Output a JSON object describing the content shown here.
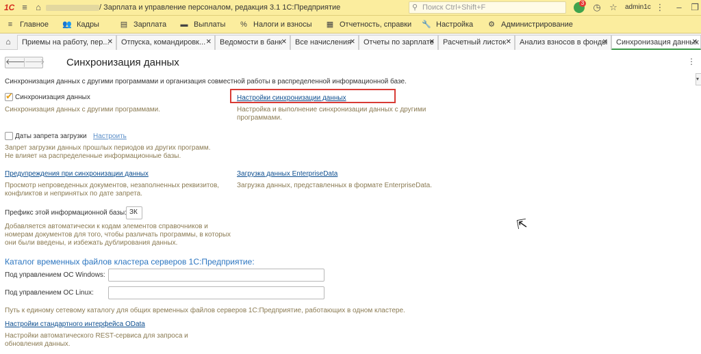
{
  "titlebar": {
    "logo": "1С",
    "app_title": "/ Зарплата и управление персоналом, редакция 3.1 1С:Предприятие",
    "search_placeholder": "Поиск Ctrl+Shift+F",
    "notification_count": "3",
    "user": "admin1c"
  },
  "menu": [
    {
      "label": "Главное",
      "icon": "menu-icon"
    },
    {
      "label": "Кадры",
      "icon": "people-icon"
    },
    {
      "label": "Зарплата",
      "icon": "wallet-icon"
    },
    {
      "label": "Выплаты",
      "icon": "payments-icon"
    },
    {
      "label": "Налоги и взносы",
      "icon": "percent-icon"
    },
    {
      "label": "Отчетность, справки",
      "icon": "reports-icon"
    },
    {
      "label": "Настройка",
      "icon": "wrench-icon"
    },
    {
      "label": "Администрирование",
      "icon": "gear-icon"
    }
  ],
  "tabs": [
    {
      "label": "Приемы на работу, пер..."
    },
    {
      "label": "Отпуска, командировк..."
    },
    {
      "label": "Ведомости в банк"
    },
    {
      "label": "Все начисления"
    },
    {
      "label": "Отчеты по зарплате"
    },
    {
      "label": "Расчетный листок"
    },
    {
      "label": "Анализ взносов в фонды"
    },
    {
      "label": "Синхронизация данных"
    }
  ],
  "page": {
    "title": "Синхронизация данных",
    "intro": "Синхронизация данных с другими программами и организация совместной работы в распределенной информационной базе."
  },
  "sync": {
    "checkbox_label": "Синхронизация данных",
    "checked": true,
    "desc": "Синхронизация данных с другими программами.",
    "settings_link": "Настройки синхронизации данных",
    "settings_desc_1": "Настройка и выполнение синхронизации данных с другими",
    "settings_desc_2": "программами."
  },
  "prohibit": {
    "checkbox_label": "Даты запрета загрузки",
    "checked": false,
    "configure_link": "Настроить",
    "desc_1": "Запрет загрузки данных прошлых периодов из других программ.",
    "desc_2": "Не влияет на распределенные информационные базы."
  },
  "warnings": {
    "link": "Предупреждения при синхронизации данных",
    "desc_1": "Просмотр непроведенных документов, незаполненных реквизитов,",
    "desc_2": "конфликтов и непринятых по дате запрета."
  },
  "enterprise_data": {
    "link": "Загрузка данных EnterpriseData",
    "desc": "Загрузка данных, представленных в формате EnterpriseData."
  },
  "prefix": {
    "label": "Префикс этой информационной базы:",
    "value": "ЗК",
    "desc_1": "Добавляется автоматически к кодам элементов справочников и",
    "desc_2": "номерам документов для того, чтобы различать программы, в которых",
    "desc_3": "они были введены, и избежать дублирования данных."
  },
  "catalog": {
    "heading": "Каталог временных файлов кластера серверов 1С:Предприятие:",
    "windows_label": "Под управлением ОС Windows:",
    "windows_value": "",
    "linux_label": "Под управлением ОС Linux:",
    "linux_value": "",
    "desc": "Путь к единому сетевому каталогу для общих временных файлов серверов 1С:Предприятие, работающих в одном кластере."
  },
  "odata": {
    "link": "Настройки стандартного интерфейса OData",
    "desc_1": "Настройки автоматического REST-сервиса для запроса и",
    "desc_2": "обновления данных."
  },
  "colors": {
    "titlebar_bg": "#fbed9e",
    "link": "#0b4d8f",
    "description_text": "#8a7a52",
    "section_heading": "#2b75c0",
    "highlight_frame": "#d83a34",
    "checkbox_mark": "#e6a017"
  }
}
